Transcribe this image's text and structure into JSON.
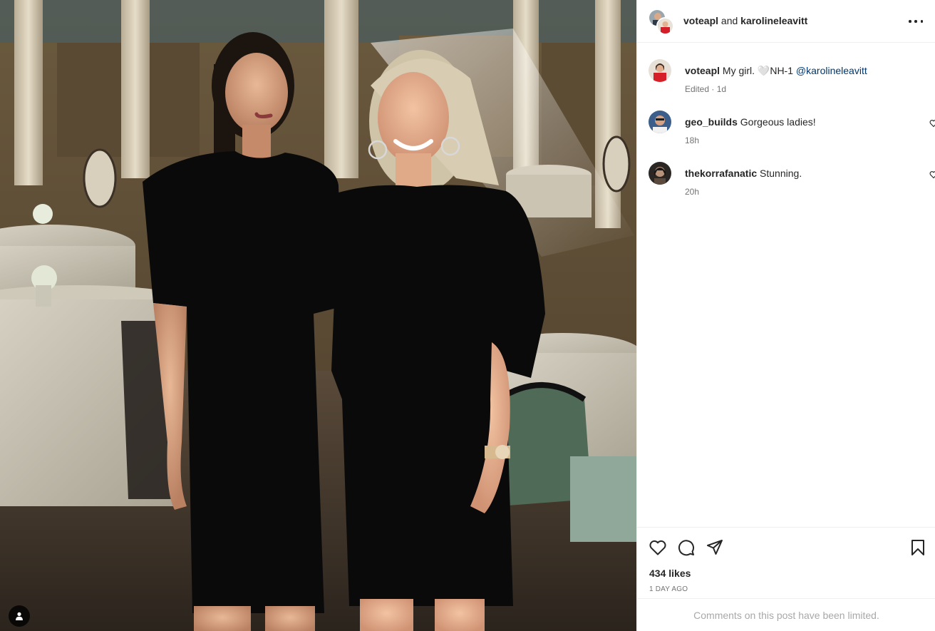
{
  "post": {
    "author": "voteapl",
    "joiner": "and",
    "collaborator": "karolineleavitt"
  },
  "caption": {
    "username": "voteapl",
    "text": "My girl. 🤍NH-1",
    "mention": "@karolineleavitt",
    "meta": "Edited · 1d"
  },
  "comments": [
    {
      "username": "geo_builds",
      "text": "Gorgeous ladies!",
      "time": "18h"
    },
    {
      "username": "thekorrafanatic",
      "text": "Stunning.",
      "time": "20h"
    }
  ],
  "likes": "434 likes",
  "timestamp": "1 DAY AGO",
  "comments_limited": "Comments on this post have been limited.",
  "icons": {
    "like": "heart-icon",
    "comment": "comment-bubble-icon",
    "share": "paper-plane-icon",
    "save": "bookmark-icon",
    "more": "more-dots-icon",
    "tagged": "person-icon"
  },
  "colors": {
    "link": "#00376b",
    "secondary_text": "#737373",
    "divider": "#efefef"
  }
}
